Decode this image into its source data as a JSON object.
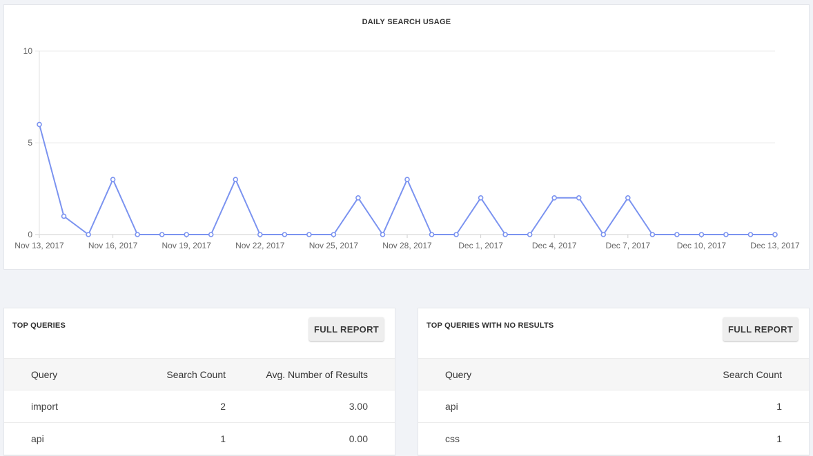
{
  "chart_data": {
    "type": "line",
    "title": "DAILY SEARCH USAGE",
    "x": [
      "Nov 13, 2017",
      "Nov 14, 2017",
      "Nov 15, 2017",
      "Nov 16, 2017",
      "Nov 17, 2017",
      "Nov 18, 2017",
      "Nov 19, 2017",
      "Nov 20, 2017",
      "Nov 21, 2017",
      "Nov 22, 2017",
      "Nov 23, 2017",
      "Nov 24, 2017",
      "Nov 25, 2017",
      "Nov 26, 2017",
      "Nov 27, 2017",
      "Nov 28, 2017",
      "Nov 29, 2017",
      "Nov 30, 2017",
      "Dec 1, 2017",
      "Dec 2, 2017",
      "Dec 3, 2017",
      "Dec 4, 2017",
      "Dec 5, 2017",
      "Dec 6, 2017",
      "Dec 7, 2017",
      "Dec 8, 2017",
      "Dec 9, 2017",
      "Dec 10, 2017",
      "Dec 11, 2017",
      "Dec 12, 2017",
      "Dec 13, 2017"
    ],
    "values": [
      6,
      1,
      0,
      3,
      0,
      0,
      0,
      0,
      3,
      0,
      0,
      0,
      0,
      2,
      0,
      3,
      0,
      0,
      2,
      0,
      0,
      2,
      2,
      0,
      2,
      0,
      0,
      0,
      0,
      0,
      0
    ],
    "x_tick_labels": [
      "Nov 13, 2017",
      "Nov 16, 2017",
      "Nov 19, 2017",
      "Nov 22, 2017",
      "Nov 25, 2017",
      "Nov 28, 2017",
      "Dec 1, 2017",
      "Dec 4, 2017",
      "Dec 7, 2017",
      "Dec 10, 2017",
      "Dec 13, 2017"
    ],
    "y_ticks": [
      0,
      5,
      10
    ],
    "ylim": [
      0,
      10
    ],
    "grid": true,
    "line_color": "#7b93f0"
  },
  "top_queries": {
    "title": "TOP QUERIES",
    "button_label": "FULL REPORT",
    "columns": [
      "Query",
      "Search Count",
      "Avg. Number of Results"
    ],
    "rows": [
      {
        "query": "import",
        "count": "2",
        "avg": "3.00"
      },
      {
        "query": "api",
        "count": "1",
        "avg": "0.00"
      }
    ]
  },
  "no_results": {
    "title": "TOP QUERIES WITH NO RESULTS",
    "button_label": "FULL REPORT",
    "columns": [
      "Query",
      "Search Count"
    ],
    "rows": [
      {
        "query": "api",
        "count": "1"
      },
      {
        "query": "css",
        "count": "1"
      }
    ]
  }
}
